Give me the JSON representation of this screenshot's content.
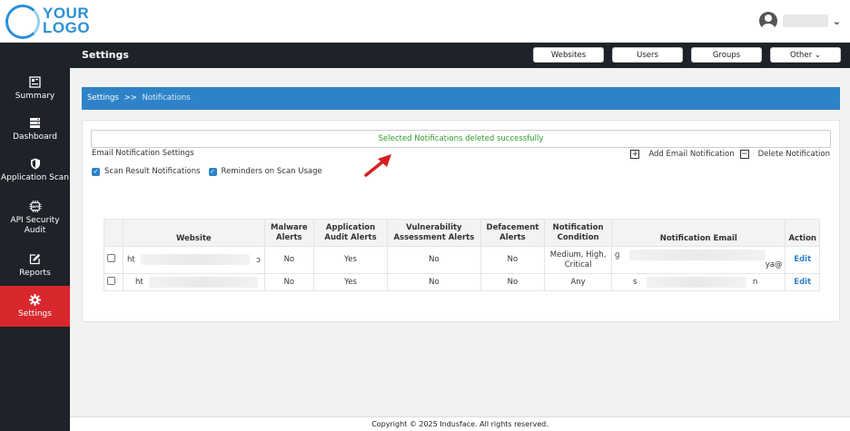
{
  "logo": {
    "line1": "YOUR",
    "line2": "LOGO"
  },
  "header": {
    "title": "Settings"
  },
  "topnav": [
    {
      "label": "Websites"
    },
    {
      "label": "Users"
    },
    {
      "label": "Groups"
    },
    {
      "label": "Other ⌄"
    }
  ],
  "sidebar": {
    "items": [
      {
        "label": "Summary",
        "icon": "summary-icon"
      },
      {
        "label": "Dashboard",
        "icon": "dashboard-icon"
      },
      {
        "label": "Application Scan",
        "icon": "shield-icon"
      },
      {
        "label": "API Security Audit",
        "icon": "api-chip-icon"
      },
      {
        "label": "Reports",
        "icon": "edit-icon"
      },
      {
        "label": "Settings",
        "icon": "gear-icon",
        "active": true
      }
    ]
  },
  "breadcrumb": {
    "parent": "Settings",
    "separator": ">>",
    "current": "Notifications"
  },
  "alert": {
    "message": "Selected Notifications deleted successfully",
    "color": "#2e9b2e"
  },
  "section": {
    "title": "Email Notification Settings",
    "add_label": "Add Email Notification",
    "delete_label": "Delete Notification"
  },
  "checks": [
    {
      "label": "Scan Result Notifications",
      "checked": true
    },
    {
      "label": "Reminders on Scan Usage",
      "checked": true
    }
  ],
  "table": {
    "headers": [
      "Website",
      "Malware Alerts",
      "Application Audit Alerts",
      "Vulnerability Assessment Alerts",
      "Defacement Alerts",
      "Notification Condition",
      "Notification Email",
      "Action"
    ],
    "rows": [
      {
        "website": "ht",
        "website_tail": "ɔ",
        "malware": "No",
        "app_audit": "Yes",
        "vuln": "No",
        "deface": "No",
        "condition": "Medium, High, Critical",
        "email_head": "ɡ",
        "email_tail": "ya@",
        "action": "Edit"
      },
      {
        "website": "ht",
        "website_tail": "",
        "malware": "No",
        "app_audit": "Yes",
        "vuln": "No",
        "deface": "No",
        "condition": "Any",
        "email_head": "s",
        "email_tail": "n",
        "action": "Edit"
      }
    ]
  },
  "footer": {
    "text": "Copyright © 2025 Indusface. All rights reserved."
  },
  "colors": {
    "accent": "#2e83c8",
    "active": "#d9272e",
    "dark": "#1e2329"
  }
}
